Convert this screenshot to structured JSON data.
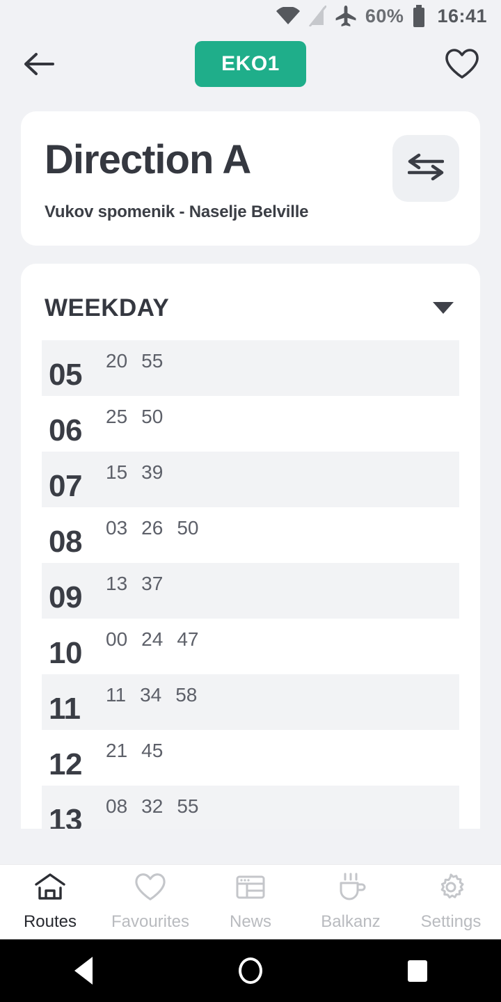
{
  "statusbar": {
    "icons": [
      "wifi-icon",
      "signal-off-icon",
      "airplane-mode-icon"
    ],
    "battery_percent": "60%",
    "battery_icon": "battery-icon",
    "time": "16:41"
  },
  "appbar": {
    "back_icon": "back-arrow-icon",
    "route_badge": "EKO1",
    "favourite_icon": "heart-outline-icon",
    "accent_color": "#1fae8a"
  },
  "direction": {
    "title": "Direction A",
    "subtitle": "Vukov spomenik - Naselje Belville",
    "swap_icon": "swap-arrows-icon"
  },
  "schedule": {
    "day_type": "WEEKDAY",
    "dropdown_icon": "chevron-down-icon",
    "rows": [
      {
        "hour": "05",
        "minutes": [
          "20",
          "55"
        ]
      },
      {
        "hour": "06",
        "minutes": [
          "25",
          "50"
        ]
      },
      {
        "hour": "07",
        "minutes": [
          "15",
          "39"
        ]
      },
      {
        "hour": "08",
        "minutes": [
          "03",
          "26",
          "50"
        ]
      },
      {
        "hour": "09",
        "minutes": [
          "13",
          "37"
        ]
      },
      {
        "hour": "10",
        "minutes": [
          "00",
          "24",
          "47"
        ]
      },
      {
        "hour": "11",
        "minutes": [
          "11",
          "34",
          "58"
        ]
      },
      {
        "hour": "12",
        "minutes": [
          "21",
          "45"
        ]
      },
      {
        "hour": "13",
        "minutes": [
          "08",
          "32",
          "55"
        ]
      }
    ]
  },
  "bottomnav": {
    "items": [
      {
        "label": "Routes",
        "icon": "home-icon",
        "active": true
      },
      {
        "label": "Favourites",
        "icon": "heart-outline-icon",
        "active": false
      },
      {
        "label": "News",
        "icon": "news-layout-icon",
        "active": false
      },
      {
        "label": "Balkanz",
        "icon": "coffee-cup-icon",
        "active": false
      },
      {
        "label": "Settings",
        "icon": "gear-icon",
        "active": false
      }
    ]
  },
  "sysnav": {
    "back": "system-back-icon",
    "home": "system-home-icon",
    "recents": "system-recents-icon"
  }
}
